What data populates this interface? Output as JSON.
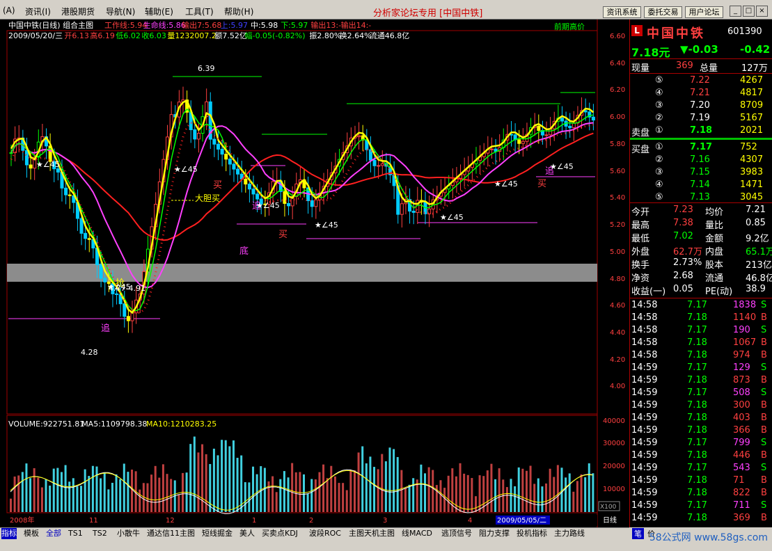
{
  "menu": [
    "(A)",
    "资讯(I)",
    "港股期货",
    "导航(N)",
    "辅助(E)",
    "工具(T)",
    "帮助(H)"
  ],
  "window_title": "分析家论坛专用 [中国中铁]",
  "top_buttons": [
    "资讯系统",
    "委托交易",
    "用户论坛"
  ],
  "chart": {
    "title": "中国中铁(日线) 组合主图",
    "indicators": [
      {
        "text": "工作线:5.94",
        "color": "#ff4040"
      },
      {
        "text": "生命线:5.86",
        "color": "#ff40ff"
      },
      {
        "text": "输出7:5.68",
        "color": "#ff4040"
      },
      {
        "text": "上:5.97",
        "color": "#4040ff"
      },
      {
        "text": "中:5.98",
        "color": "#ffffff"
      },
      {
        "text": "下:5.97",
        "color": "#00ff00"
      },
      {
        "text": "输出13:-",
        "color": "#ff4040"
      },
      {
        "text": "输出14:-",
        "color": "#ff4040"
      }
    ],
    "right_title": "前期高价",
    "info_line": [
      {
        "text": "2009/05/20/三",
        "color": "#ffffff"
      },
      {
        "text": "开6.13",
        "color": "#ff4040"
      },
      {
        "text": "高6.19",
        "color": "#ff4040"
      },
      {
        "text": "低6.02",
        "color": "#00ff00"
      },
      {
        "text": "收6.03",
        "color": "#00ff00"
      },
      {
        "text": "量1232007.2",
        "color": "#ffff00"
      },
      {
        "text": "额7.52亿",
        "color": "#ffffff"
      },
      {
        "text": "幅-0.05(-0.82%)",
        "color": "#00ff00"
      },
      {
        "text": "振2.80%",
        "color": "#ffffff"
      },
      {
        "text": "换2.64%",
        "color": "#ffffff"
      },
      {
        "text": "流通46.8亿",
        "color": "#ffffff"
      }
    ],
    "price_axis": [
      "6.60",
      "6.40",
      "6.20",
      "6.00",
      "5.80",
      "5.60",
      "5.40",
      "5.20",
      "5.00",
      "4.80",
      "4.60",
      "4.40",
      "4.20",
      "4.00"
    ],
    "annotations": [
      {
        "text": "6.39",
        "color": "#ffffff"
      },
      {
        "text": "4.77-4.91",
        "color": "#ffffff"
      },
      {
        "text": "4.28",
        "color": "#ffffff"
      },
      {
        "text": "大胆买",
        "color": "#ffff00"
      },
      {
        "text": "追",
        "color": "#ff40ff"
      },
      {
        "text": "底",
        "color": "#ff40ff"
      },
      {
        "text": "买",
        "color": "#ff4040"
      },
      {
        "text": "抢",
        "color": "#ffff00"
      },
      {
        "text": "∠45",
        "color": "#ffffff"
      }
    ],
    "volume": {
      "title_parts": [
        {
          "text": "VOLUME:922751.81",
          "color": "#ffffff"
        },
        {
          "text": "MA5:1109798.38",
          "color": "#ffffff"
        },
        {
          "text": "MA10:1210283.25",
          "color": "#ffff00"
        }
      ],
      "axis": [
        "40000",
        "30000",
        "20000",
        "10000"
      ],
      "unit": "X100"
    },
    "x_axis": [
      "2008年",
      "11",
      "12",
      "1",
      "2",
      "3",
      "4"
    ],
    "x_highlight": "2009/05/05/二",
    "period": "日线"
  },
  "quote": {
    "name": "中国中铁",
    "code": "601390",
    "price": "7.18元",
    "change": "▼-0.03",
    "change_right": "-0.42",
    "xianliang_label": "现量",
    "xianliang": "369",
    "zongliang_label": "总量",
    "zongliang": "127万",
    "sell_label": "卖盘",
    "buy_label": "买盘",
    "asks": [
      {
        "lvl": "⑤",
        "p": "7.22",
        "v": "4267"
      },
      {
        "lvl": "④",
        "p": "7.21",
        "v": "4817"
      },
      {
        "lvl": "③",
        "p": "7.20",
        "v": "8709"
      },
      {
        "lvl": "②",
        "p": "7.19",
        "v": "5167"
      },
      {
        "lvl": "①",
        "p": "7.18",
        "v": "2021"
      }
    ],
    "bids": [
      {
        "lvl": "①",
        "p": "7.17",
        "v": "752"
      },
      {
        "lvl": "②",
        "p": "7.16",
        "v": "4307"
      },
      {
        "lvl": "③",
        "p": "7.15",
        "v": "3983"
      },
      {
        "lvl": "④",
        "p": "7.14",
        "v": "1471"
      },
      {
        "lvl": "⑤",
        "p": "7.13",
        "v": "3045"
      }
    ],
    "stats": [
      [
        "今开",
        "7.23",
        "均价",
        "7.21"
      ],
      [
        "最高",
        "7.38",
        "量比",
        "0.85"
      ],
      [
        "最低",
        "7.02",
        "金额",
        "9.2亿"
      ],
      [
        "外盘",
        "62.7万",
        "内盘",
        "65.1万"
      ],
      [
        "换手",
        "2.73%",
        "股本",
        "213亿"
      ],
      [
        "净资",
        "2.68",
        "流通",
        "46.8亿"
      ],
      [
        "收益(一)",
        "0.05",
        "PE(动)",
        "38.9"
      ]
    ],
    "ticks": [
      [
        "14:58",
        "7.17",
        "1838",
        "S"
      ],
      [
        "14:58",
        "7.18",
        "1140",
        "B"
      ],
      [
        "14:58",
        "7.17",
        "190",
        "S"
      ],
      [
        "14:58",
        "7.18",
        "1067",
        "B"
      ],
      [
        "14:58",
        "7.18",
        "974",
        "B"
      ],
      [
        "14:59",
        "7.17",
        "129",
        "S"
      ],
      [
        "14:59",
        "7.18",
        "873",
        "B"
      ],
      [
        "14:59",
        "7.17",
        "508",
        "S"
      ],
      [
        "14:59",
        "7.18",
        "300",
        "B"
      ],
      [
        "14:59",
        "7.18",
        "403",
        "B"
      ],
      [
        "14:59",
        "7.18",
        "366",
        "B"
      ],
      [
        "14:59",
        "7.17",
        "799",
        "S"
      ],
      [
        "14:59",
        "7.18",
        "446",
        "B"
      ],
      [
        "14:59",
        "7.17",
        "543",
        "S"
      ],
      [
        "14:59",
        "7.18",
        "71",
        "B"
      ],
      [
        "14:59",
        "7.18",
        "822",
        "B"
      ],
      [
        "14:59",
        "7.17",
        "711",
        "S"
      ],
      [
        "14:59",
        "7.18",
        "369",
        "B"
      ]
    ]
  },
  "tabs": [
    "指标",
    "模板",
    "全部",
    "TS1",
    "TS2",
    "小散牛",
    "通达信11主图",
    "短线掘金",
    "美人",
    "买卖点KDJ",
    "波段ROC",
    "主图天机主图",
    "线MACD",
    "逃顶信号",
    "阻力支撑",
    "投机指标",
    "主力路线"
  ],
  "status": {
    "left": "笔",
    "right": "价"
  },
  "watermark": "58公式网 www.58gs.com"
}
